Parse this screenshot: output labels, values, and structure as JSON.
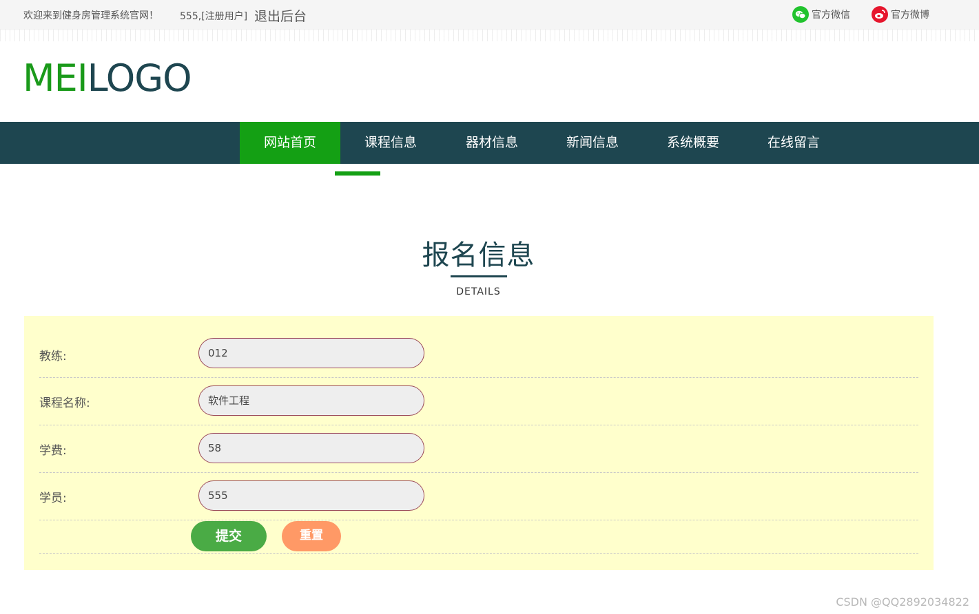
{
  "topbar": {
    "welcome": "欢迎来到健身房管理系统官网！",
    "user": "555,[注册用户]",
    "logout": "退出后台",
    "wechat_label": "官方微信",
    "weibo_label": "官方微博",
    "wechat_icon": "wechat-icon",
    "weibo_icon": "weibo-icon"
  },
  "logo": {
    "part_green": "MEI",
    "part_dark": "LOGO"
  },
  "nav": {
    "items": [
      {
        "label": "网站首页",
        "active": true
      },
      {
        "label": "课程信息"
      },
      {
        "label": "器材信息"
      },
      {
        "label": "新闻信息"
      },
      {
        "label": "系统概要"
      },
      {
        "label": "在线留言"
      }
    ]
  },
  "page": {
    "title": "报名信息",
    "subtitle": "DETAILS"
  },
  "form": {
    "fields": [
      {
        "label": "教练:",
        "value": "012"
      },
      {
        "label": "课程名称:",
        "value": "软件工程"
      },
      {
        "label": "学费:",
        "value": "58"
      },
      {
        "label": "学员:",
        "value": "555"
      }
    ],
    "submit": "提交",
    "reset": "重置"
  },
  "watermark": "CSDN @QQ2892034822",
  "colors": {
    "nav_bg": "#1e4650",
    "accent_green": "#14a014",
    "panel_bg": "#ffffcc",
    "submit_bg": "#4aab45",
    "reset_bg": "#ff9966"
  }
}
